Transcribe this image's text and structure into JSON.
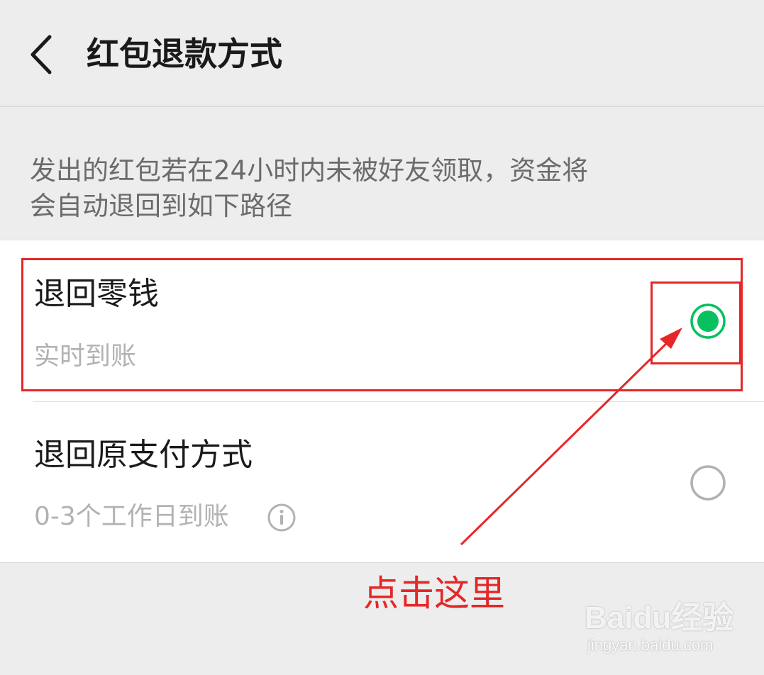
{
  "header": {
    "back_icon": "chevron-left-icon",
    "title": "红包退款方式"
  },
  "description": {
    "line1": "发出的红包若在24小时内未被好友领取，资金将",
    "line2": "会自动退回到如下路径"
  },
  "options": [
    {
      "title": "退回零钱",
      "subtitle": "实时到账",
      "selected": true
    },
    {
      "title": "退回原支付方式",
      "subtitle": "0-3个工作日到账",
      "selected": false,
      "info_icon": "info-icon"
    }
  ],
  "annotation": {
    "callout": "点击这里",
    "color": "#e52727"
  },
  "watermark": {
    "logo": "Baidu经验",
    "url": "jingyan.baidu.com"
  },
  "colors": {
    "accent_green": "#07c160",
    "background": "#ededed",
    "card": "#ffffff"
  }
}
